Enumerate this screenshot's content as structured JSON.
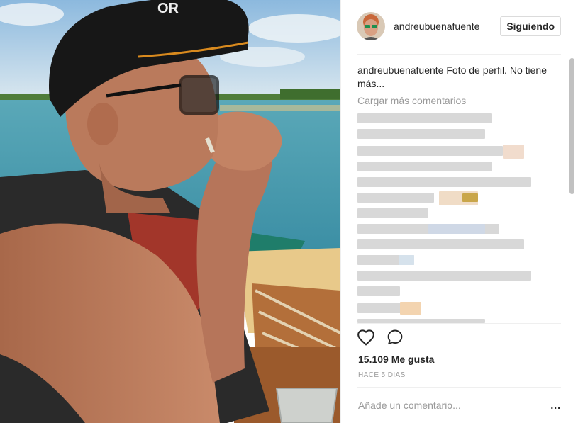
{
  "post": {
    "username": "andreubuenafuente",
    "follow_label": "Siguiendo",
    "caption_user": "andreubuenafuente",
    "caption_text": "Foto de perfil. No tiene más...",
    "load_more": "Cargar más comentarios",
    "likes": "15.109 Me gusta",
    "timestamp": "HACE 5 DÍAS",
    "comment_placeholder": "Añade un comentario...",
    "more_options": "..."
  },
  "photo": {
    "cap_text": "OR"
  },
  "icons": {
    "like": "heart-icon",
    "comment": "comment-bubble-icon",
    "more": "ellipsis-icon"
  },
  "colors": {
    "accent": "#262626",
    "muted": "#999999",
    "border": "#dbdbdb"
  }
}
